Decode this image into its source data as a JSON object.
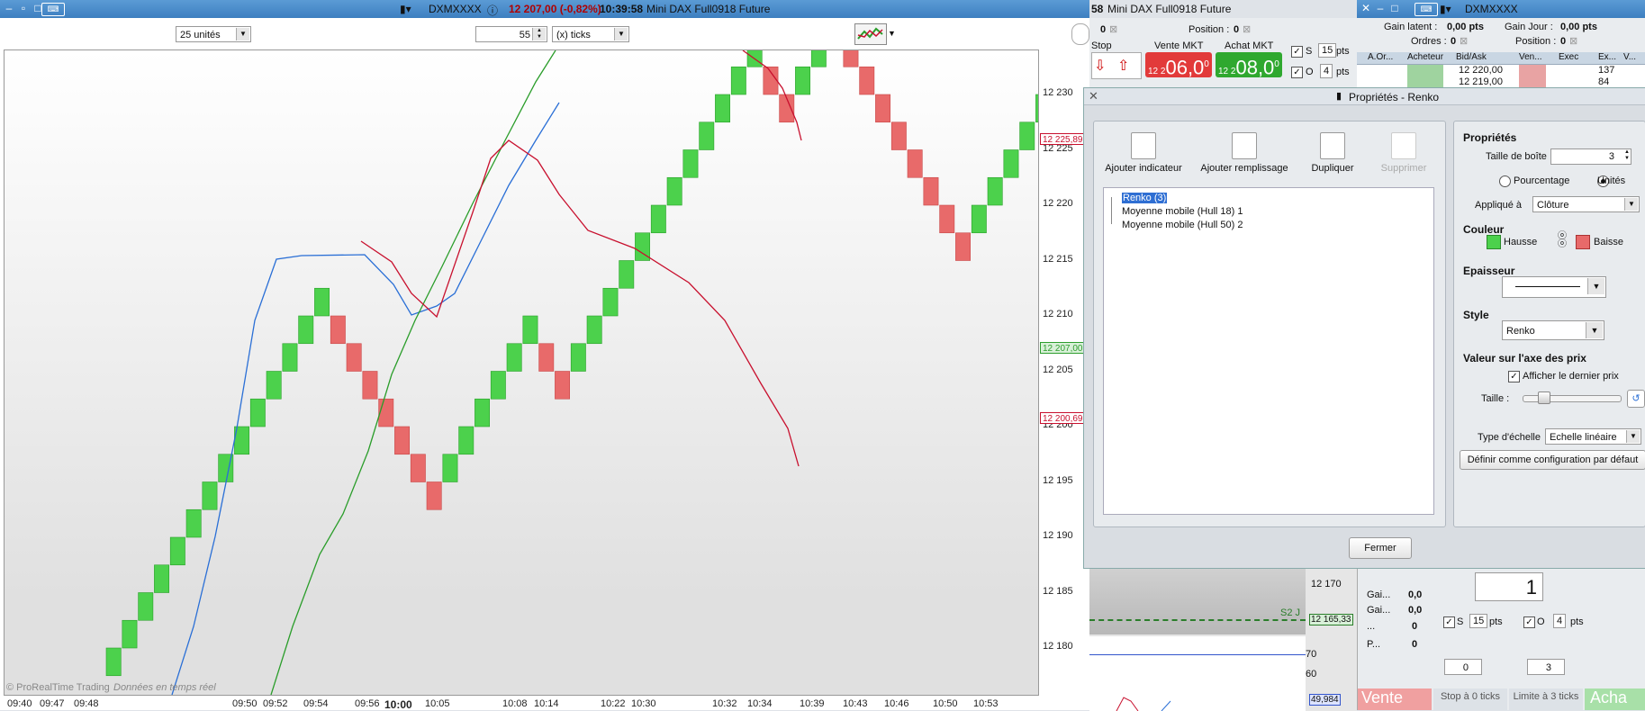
{
  "main_window": {
    "instrument": "DXMXXXX",
    "price_change": "12 207,00 (-0,82%)",
    "time": "10:39:58",
    "product": "Mini DAX Full0918 Future"
  },
  "chart_toolbar": {
    "units_select": "25 unités",
    "ticks_value": "55",
    "ticks_select": "(x) ticks"
  },
  "chart_data": {
    "type": "renko",
    "box_size": 3,
    "yticks": [
      12180,
      12185,
      12190,
      12195,
      12200,
      12205,
      12210,
      12215,
      12220,
      12225,
      12230
    ],
    "ytick_labels": [
      "12 180",
      "12 185",
      "12 190",
      "12 195",
      "12 200",
      "12 205",
      "12 210",
      "12 215",
      "12 220",
      "12 225",
      "12 230"
    ],
    "xtick_labels": [
      "09:40",
      "09:47",
      "09:48",
      "09:50",
      "09:52",
      "09:54",
      "09:56",
      "10:00",
      "10:05",
      "10:08",
      "10:14",
      "10:22",
      "10:30",
      "10:32",
      "10:34",
      "10:39",
      "10:43",
      "10:46",
      "10:50",
      "10:53"
    ],
    "price_tags": [
      {
        "label": "12 225,89",
        "value": 12225.89,
        "color": "#c8102e"
      },
      {
        "label": "12 207,00",
        "value": 12207.0,
        "color": "#2e9e2e"
      },
      {
        "label": "12 200,69",
        "value": 12200.69,
        "color": "#c8102e"
      }
    ],
    "series": [
      {
        "name": "Renko (3)"
      },
      {
        "name": "Moyenne mobile (Hull 18) 1",
        "color": "#c8102e"
      },
      {
        "name": "Moyenne mobile (Hull 50) 2",
        "color": "#2a6fd6"
      }
    ],
    "colors": {
      "up": "#4cd14c",
      "down": "#e86a6a"
    },
    "watermark": "© ProRealTime Trading",
    "data_note": "Données en temps réel"
  },
  "order_panel": {
    "title_number": "58",
    "product": "Mini DAX Full0918 Future",
    "qty": "0",
    "position_label": "Position :",
    "position_value": "0",
    "stop_label": "Stop",
    "sell_label": "Vente MKT",
    "buy_label": "Achat MKT",
    "sell_prefix": "12 2",
    "sell_price": "06,0",
    "sell_sup": "0",
    "buy_prefix": "12 2",
    "buy_price": "08,0",
    "buy_sup": "0",
    "s_label": "S",
    "s_value": "15",
    "o_label": "O",
    "o_value": "4",
    "pts": "pts"
  },
  "right_window": {
    "instrument": "DXMXXXX",
    "gain_latent_label": "Gain latent :",
    "gain_latent_value": "0,00 pts",
    "gain_jour_label": "Gain Jour :",
    "gain_jour_value": "0,00 pts",
    "ordres_label": "Ordres :",
    "ordres_value": "0",
    "position_label": "Position :",
    "position_value": "0",
    "book_headers": [
      "A.Or...",
      "Acheteur",
      "Bid/Ask",
      "Ven...",
      "Exec",
      "Ex...",
      "V..."
    ],
    "book_rows": [
      {
        "price": "12 220,00",
        "vol": "137"
      },
      {
        "price": "12 219,00",
        "vol": "84"
      }
    ]
  },
  "dialog": {
    "title": "Propriétés - Renko",
    "toolbar": {
      "add_indicator": "Ajouter indicateur",
      "add_fill": "Ajouter remplissage",
      "duplicate": "Dupliquer",
      "delete": "Supprimer"
    },
    "tree": [
      "Renko (3)",
      "Moyenne mobile (Hull 18) 1",
      "Moyenne mobile (Hull 50) 2"
    ],
    "props": {
      "section": "Propriétés",
      "box_size_label": "Taille de boîte",
      "box_size_value": "3",
      "radio_percent": "Pourcentage",
      "radio_units": "Unités",
      "applied_label": "Appliqué à",
      "applied_value": "Clôture",
      "color_section": "Couleur",
      "up_label": "Hausse",
      "down_label": "Baisse",
      "thickness_section": "Epaisseur",
      "style_section": "Style",
      "style_value": "Renko",
      "price_axis_section": "Valeur sur l'axe des prix",
      "show_last_price": "Afficher le dernier prix",
      "size_label": "Taille :",
      "scale_type_label": "Type d'échelle",
      "scale_type_value": "Echelle linéaire",
      "default_button": "Définir comme configuration par défaut"
    },
    "close_button": "Fermer"
  },
  "lower_panels": {
    "y_labels": [
      "12 170",
      "60",
      "70"
    ],
    "s2_label": "S2 J",
    "price_tag": "12 165,33",
    "indicator_tag": "49,984",
    "gain_labels": [
      "Gai...",
      "Gai...",
      "...",
      "P..."
    ],
    "gain_values": [
      "0,0",
      "0,0",
      "0",
      "0"
    ],
    "qty_value": "1",
    "s_label": "S",
    "s_value": "15",
    "o_label": "O",
    "o_value": "4",
    "pts": "pts",
    "spin_left": "0",
    "spin_right": "3",
    "bottom_sell": "Vente",
    "bottom_stop": "Stop à 0 ticks",
    "bottom_limit": "Limite à 3 ticks",
    "bottom_buy": "Acha"
  }
}
